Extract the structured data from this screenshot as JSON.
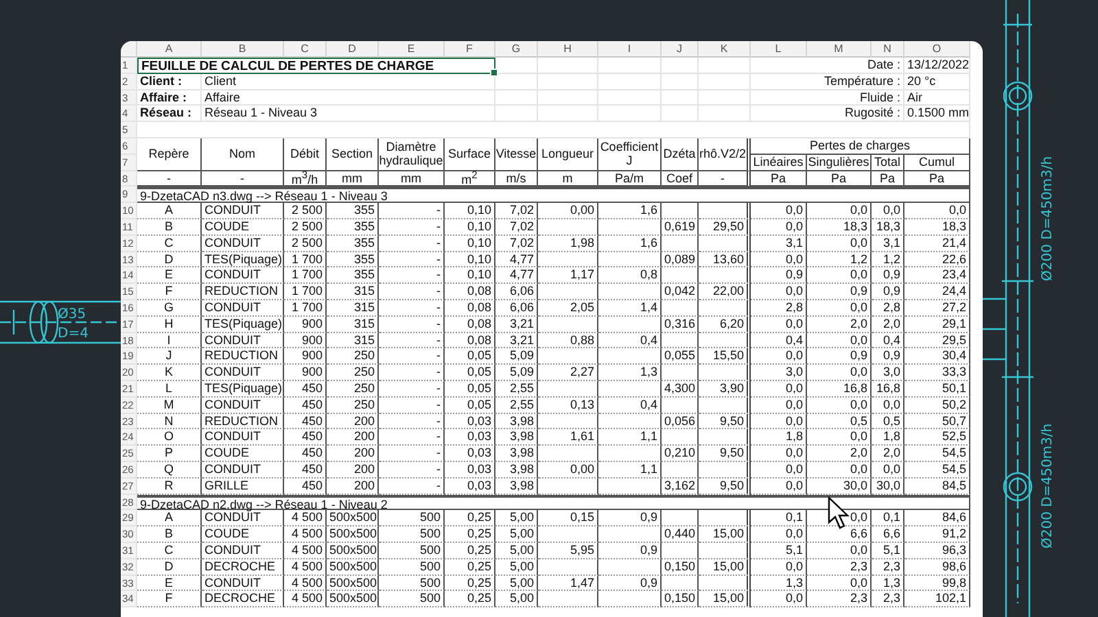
{
  "column_letters": [
    "A",
    "B",
    "C",
    "D",
    "E",
    "F",
    "G",
    "H",
    "I",
    "J",
    "K",
    "L",
    "M",
    "N",
    "O"
  ],
  "row_numbers": [
    "1",
    "2",
    "3",
    "4",
    "5",
    "6",
    "7",
    "8",
    "9",
    "10",
    "11",
    "12",
    "13",
    "14",
    "15",
    "16",
    "17",
    "18",
    "19",
    "20",
    "21",
    "22",
    "23",
    "24",
    "25",
    "26",
    "27",
    "28",
    "29",
    "30",
    "31",
    "32",
    "33",
    "34"
  ],
  "title": {
    "text": "FEUILLE DE CALCUL DE PERTES DE CHARGE",
    "selected": true
  },
  "info_left": [
    {
      "label": "Client :",
      "value": "Client"
    },
    {
      "label": "Affaire :",
      "value": "Affaire"
    },
    {
      "label": "Réseau :",
      "value": "Réseau 1 - Niveau 3"
    }
  ],
  "info_right": [
    {
      "label": "Date :",
      "value": "13/12/2022"
    },
    {
      "label": "Température :",
      "value": "20 °c"
    },
    {
      "label": "Fluide :",
      "value": "Air"
    },
    {
      "label": "Rugosité :",
      "value": "0.1500 mm"
    }
  ],
  "headers": [
    "Repère",
    "Nom",
    "Débit",
    "Section",
    "Diamètre hydraulique",
    "Surface",
    "Vitesse",
    "Longueur",
    "Coefficient J",
    "Dzéta",
    "rhô.V2/2"
  ],
  "losses_header": "Pertes de charges",
  "losses_columns": [
    "Linéaires",
    "Singulières",
    "Total",
    "Cumul"
  ],
  "units": [
    "-",
    "-",
    "m$^{3}$/h",
    "mm",
    "mm",
    "m$^{2}$",
    "m/s",
    "m",
    "Pa/m",
    "Coef",
    "-",
    "Pa",
    "Pa",
    "Pa",
    "Pa"
  ],
  "sections": [
    {
      "title": "9-DzetaCAD n3.dwg --> Réseau 1 - Niveau 3",
      "rows": [
        [
          "A",
          "CONDUIT",
          "2 500",
          "355",
          "-",
          "0,10",
          "7,02",
          "0,00",
          "1,6",
          null,
          null,
          "0,0",
          "0,0",
          "0,0",
          "0,0"
        ],
        [
          "B",
          "COUDE",
          "2 500",
          "355",
          "-",
          "0,10",
          "7,02",
          null,
          null,
          "0,619",
          "29,50",
          "0,0",
          "18,3",
          "18,3",
          "18,3"
        ],
        [
          "C",
          "CONDUIT",
          "2 500",
          "355",
          "-",
          "0,10",
          "7,02",
          "1,98",
          "1,6",
          null,
          null,
          "3,1",
          "0,0",
          "3,1",
          "21,4"
        ],
        [
          "D",
          "TES(Piquage)",
          "1 700",
          "355",
          "-",
          "0,10",
          "4,77",
          null,
          null,
          "0,089",
          "13,60",
          "0,0",
          "1,2",
          "1,2",
          "22,6"
        ],
        [
          "E",
          "CONDUIT",
          "1 700",
          "355",
          "-",
          "0,10",
          "4,77",
          "1,17",
          "0,8",
          null,
          null,
          "0,9",
          "0,0",
          "0,9",
          "23,4"
        ],
        [
          "F",
          "REDUCTION",
          "1 700",
          "315",
          "-",
          "0,08",
          "6,06",
          null,
          null,
          "0,042",
          "22,00",
          "0,0",
          "0,9",
          "0,9",
          "24,4"
        ],
        [
          "G",
          "CONDUIT",
          "1 700",
          "315",
          "-",
          "0,08",
          "6,06",
          "2,05",
          "1,4",
          null,
          null,
          "2,8",
          "0,0",
          "2,8",
          "27,2"
        ],
        [
          "H",
          "TES(Piquage)",
          "900",
          "315",
          "-",
          "0,08",
          "3,21",
          null,
          null,
          "0,316",
          "6,20",
          "0,0",
          "2,0",
          "2,0",
          "29,1"
        ],
        [
          "I",
          "CONDUIT",
          "900",
          "315",
          "-",
          "0,08",
          "3,21",
          "0,88",
          "0,4",
          null,
          null,
          "0,4",
          "0,0",
          "0,4",
          "29,5"
        ],
        [
          "J",
          "REDUCTION",
          "900",
          "250",
          "-",
          "0,05",
          "5,09",
          null,
          null,
          "0,055",
          "15,50",
          "0,0",
          "0,9",
          "0,9",
          "30,4"
        ],
        [
          "K",
          "CONDUIT",
          "900",
          "250",
          "-",
          "0,05",
          "5,09",
          "2,27",
          "1,3",
          null,
          null,
          "3,0",
          "0,0",
          "3,0",
          "33,3"
        ],
        [
          "L",
          "TES(Piquage)",
          "450",
          "250",
          "-",
          "0,05",
          "2,55",
          null,
          null,
          "4,300",
          "3,90",
          "0,0",
          "16,8",
          "16,8",
          "50,1"
        ],
        [
          "M",
          "CONDUIT",
          "450",
          "250",
          "-",
          "0,05",
          "2,55",
          "0,13",
          "0,4",
          null,
          null,
          "0,0",
          "0,0",
          "0,0",
          "50,2"
        ],
        [
          "N",
          "REDUCTION",
          "450",
          "200",
          "-",
          "0,03",
          "3,98",
          null,
          null,
          "0,056",
          "9,50",
          "0,0",
          "0,5",
          "0,5",
          "50,7"
        ],
        [
          "O",
          "CONDUIT",
          "450",
          "200",
          "-",
          "0,03",
          "3,98",
          "1,61",
          "1,1",
          null,
          null,
          "1,8",
          "0,0",
          "1,8",
          "52,5"
        ],
        [
          "P",
          "COUDE",
          "450",
          "200",
          "-",
          "0,03",
          "3,98",
          null,
          null,
          "0,210",
          "9,50",
          "0,0",
          "2,0",
          "2,0",
          "54,5"
        ],
        [
          "Q",
          "CONDUIT",
          "450",
          "200",
          "-",
          "0,03",
          "3,98",
          "0,00",
          "1,1",
          null,
          null,
          "0,0",
          "0,0",
          "0,0",
          "54,5"
        ],
        [
          "R",
          "GRILLE",
          "450",
          "200",
          "-",
          "0,03",
          "3,98",
          null,
          null,
          "3,162",
          "9,50",
          "0,0",
          "30,0",
          "30,0",
          "84,5"
        ]
      ]
    },
    {
      "title": "9-DzetaCAD n2.dwg --> Réseau 1 - Niveau 2",
      "rows": [
        [
          "A",
          "CONDUIT",
          "4 500",
          "500x500",
          "500",
          "0,25",
          "5,00",
          "0,15",
          "0,9",
          null,
          null,
          "0,1",
          "0,0",
          "0,1",
          "84,6"
        ],
        [
          "B",
          "COUDE",
          "4 500",
          "500x500",
          "500",
          "0,25",
          "5,00",
          null,
          null,
          "0,440",
          "15,00",
          "0,0",
          "6,6",
          "6,6",
          "91,2"
        ],
        [
          "C",
          "CONDUIT",
          "4 500",
          "500x500",
          "500",
          "0,25",
          "5,00",
          "5,95",
          "0,9",
          null,
          null,
          "5,1",
          "0,0",
          "5,1",
          "96,3"
        ],
        [
          "D",
          "DECROCHE",
          "4 500",
          "500x500",
          "500",
          "0,25",
          "5,00",
          null,
          null,
          "0,150",
          "15,00",
          "0,0",
          "2,3",
          "2,3",
          "98,6"
        ],
        [
          "E",
          "CONDUIT",
          "4 500",
          "500x500",
          "500",
          "0,25",
          "5,00",
          "1,47",
          "0,9",
          null,
          null,
          "1,3",
          "0,0",
          "1,3",
          "99,8"
        ],
        [
          "F",
          "DECROCHE",
          "4 500",
          "500x500",
          "500",
          "0,25",
          "5,00",
          null,
          null,
          "0,150",
          "15,00",
          "0,0",
          "2,3",
          "2,3",
          "102,1"
        ]
      ]
    }
  ],
  "drawing_labels": {
    "left": [
      "Ø35",
      "D=4"
    ],
    "right": [
      "Ø200 D=450m3/h",
      "Ø200 D=450m3/h"
    ]
  }
}
